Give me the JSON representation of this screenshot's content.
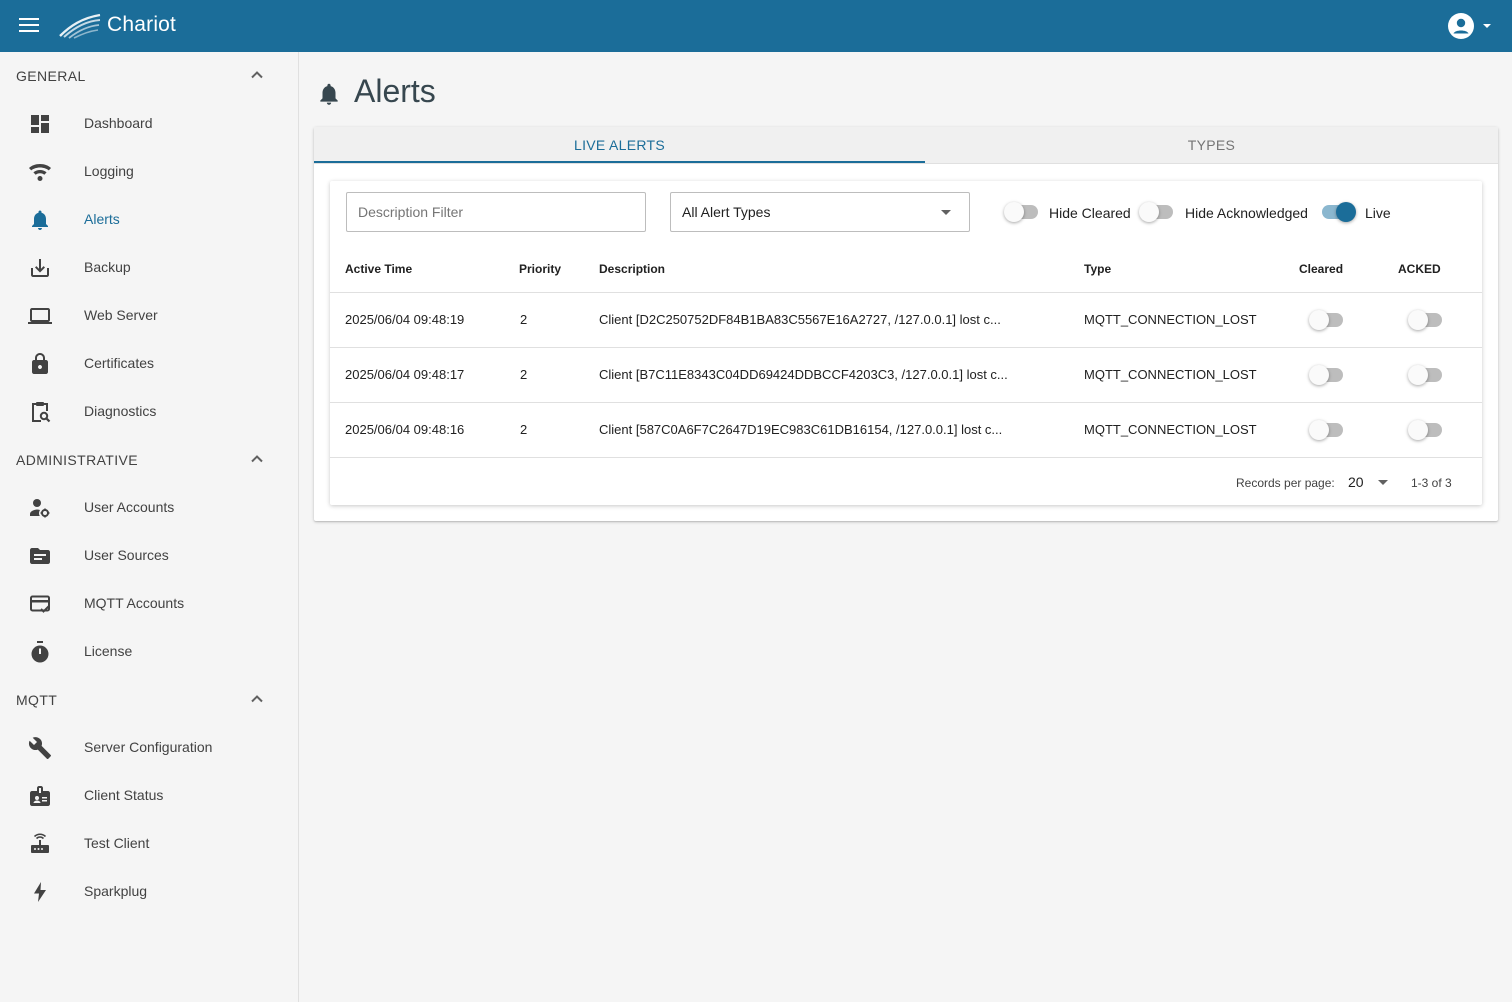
{
  "app": {
    "brand": "Chariot"
  },
  "sidebar": {
    "sections": [
      {
        "title": "GENERAL",
        "items": [
          {
            "label": "Dashboard",
            "icon": "dashboard-icon"
          },
          {
            "label": "Logging",
            "icon": "logging-icon"
          },
          {
            "label": "Alerts",
            "icon": "bell-icon",
            "active": true
          },
          {
            "label": "Backup",
            "icon": "download-icon"
          },
          {
            "label": "Web Server",
            "icon": "laptop-icon"
          },
          {
            "label": "Certificates",
            "icon": "lock-icon"
          },
          {
            "label": "Diagnostics",
            "icon": "clipboard-search-icon"
          }
        ]
      },
      {
        "title": "ADMINISTRATIVE",
        "items": [
          {
            "label": "User Accounts",
            "icon": "user-gear-icon"
          },
          {
            "label": "User Sources",
            "icon": "folder-icon"
          },
          {
            "label": "MQTT Accounts",
            "icon": "card-check-icon"
          },
          {
            "label": "License",
            "icon": "timer-icon"
          }
        ]
      },
      {
        "title": "MQTT",
        "items": [
          {
            "label": "Server Configuration",
            "icon": "wrench-icon"
          },
          {
            "label": "Client Status",
            "icon": "badge-icon"
          },
          {
            "label": "Test Client",
            "icon": "router-icon"
          },
          {
            "label": "Sparkplug",
            "icon": "lightning-icon"
          }
        ]
      }
    ]
  },
  "page": {
    "title": "Alerts"
  },
  "tabs": [
    {
      "label": "LIVE ALERTS",
      "active": true
    },
    {
      "label": "TYPES",
      "active": false
    }
  ],
  "filters": {
    "description_placeholder": "Description Filter",
    "alert_type": "All Alert Types",
    "hide_cleared": {
      "label": "Hide Cleared",
      "on": false
    },
    "hide_acknowledged": {
      "label": "Hide Acknowledged",
      "on": false
    },
    "live": {
      "label": "Live",
      "on": true
    }
  },
  "table": {
    "columns": [
      "Active Time",
      "Priority",
      "Description",
      "Type",
      "Cleared",
      "ACKED"
    ],
    "rows": [
      {
        "active_time": "2025/06/04 09:48:19",
        "priority": "2",
        "description": "Client [D2C250752DF84B1BA83C5567E16A2727, /127.0.0.1] lost c...",
        "type": "MQTT_CONNECTION_LOST",
        "cleared": false,
        "acked": false
      },
      {
        "active_time": "2025/06/04 09:48:17",
        "priority": "2",
        "description": "Client [B7C11E8343C04DD69424DDBCCF4203C3, /127.0.0.1] lost c...",
        "type": "MQTT_CONNECTION_LOST",
        "cleared": false,
        "acked": false
      },
      {
        "active_time": "2025/06/04 09:48:16",
        "priority": "2",
        "description": "Client [587C0A6F7C2647D19EC983C61DB16154, /127.0.0.1] lost c...",
        "type": "MQTT_CONNECTION_LOST",
        "cleared": false,
        "acked": false
      }
    ]
  },
  "pagination": {
    "records_per_page_label": "Records per page:",
    "records_per_page": "20",
    "range": "1-3 of 3"
  },
  "colors": {
    "primary": "#1b6d99",
    "background": "#f5f5f5"
  }
}
